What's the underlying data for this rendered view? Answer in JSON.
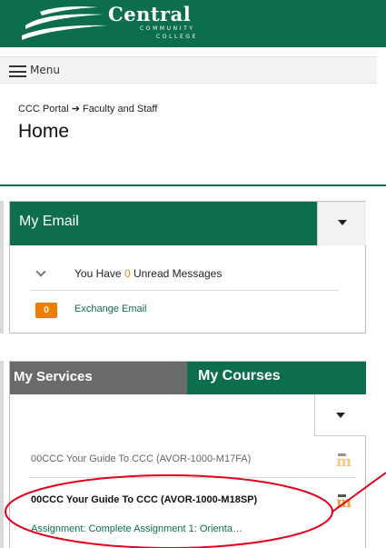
{
  "header": {
    "logo_main": "Central",
    "logo_sub_line1": "COMMUNITY",
    "logo_sub_line2": "COLLEGE",
    "brand_color": "#0c6e4a"
  },
  "menu": {
    "label": "Menu",
    "icon": "hamburger-icon"
  },
  "breadcrumb": {
    "root": "CCC Portal",
    "separator": "➔",
    "current": "Faculty and Staff"
  },
  "page": {
    "title": "Home"
  },
  "email_widget": {
    "title": "My Email",
    "unread_prefix": "You Have ",
    "unread_count": "0",
    "unread_suffix": " Unread Messages",
    "exchange_badge": "0",
    "exchange_label": "Exchange Email",
    "badge_color": "#ef7d00"
  },
  "courses_widget": {
    "tabs": [
      {
        "label": "My Services",
        "active": false
      },
      {
        "label": "My Courses",
        "active": true
      }
    ],
    "courses": [
      {
        "label": "00CCC Your Guide To CCC (AVOR-1000-M17FA)",
        "icon": "moodle-icon"
      },
      {
        "label": "00CCC Your Guide To CCC (AVOR-1000-M18SP)",
        "icon": "moodle-icon"
      }
    ],
    "assignment": "Assignment: Complete Assignment 1: Orienta…",
    "icon_glyph": "m"
  },
  "annotation_color": "#e2001a"
}
